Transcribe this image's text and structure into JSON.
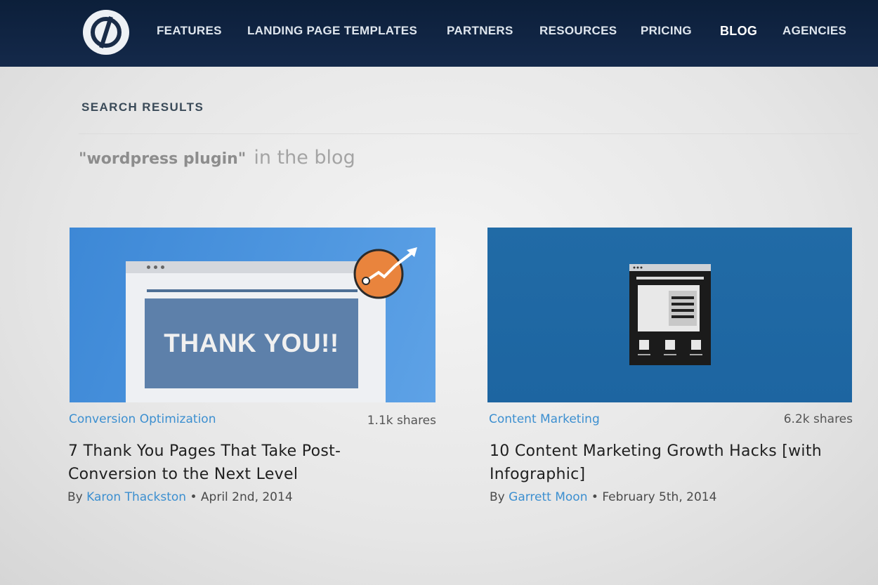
{
  "nav": {
    "logo_icon": "unbounce-logo-icon",
    "links": [
      {
        "label": "FEATURES",
        "active": false
      },
      {
        "label": "LANDING PAGE TEMPLATES",
        "active": false
      },
      {
        "label": "PARTNERS",
        "active": false
      },
      {
        "label": "RESOURCES",
        "active": false
      },
      {
        "label": "PRICING",
        "active": false
      },
      {
        "label": "BLOG",
        "active": true
      },
      {
        "label": "AGENCIES",
        "active": false
      }
    ]
  },
  "search": {
    "section_label": "SEARCH RESULTS",
    "query": "\"wordpress plugin\"",
    "suffix": "in the blog"
  },
  "posts": [
    {
      "category": "Conversion Optimization",
      "shares": "1.1k shares",
      "title": "7 Thank You Pages That Take Post-Conversion to the Next Level",
      "by": "By",
      "author": "Karon Thackston",
      "separator": "•",
      "date": "April 2nd, 2014",
      "thumb_text": "THANK YOU!!"
    },
    {
      "category": "Content Marketing",
      "shares": "6.2k shares",
      "title": "10 Content Marketing Growth Hacks [with Infographic]",
      "by": "By",
      "author": "Garrett Moon",
      "separator": "•",
      "date": "February 5th, 2014"
    }
  ],
  "colors": {
    "nav_bg": "#0f2342",
    "link_blue": "#3c8fd0",
    "badge_orange": "#e9843d"
  }
}
